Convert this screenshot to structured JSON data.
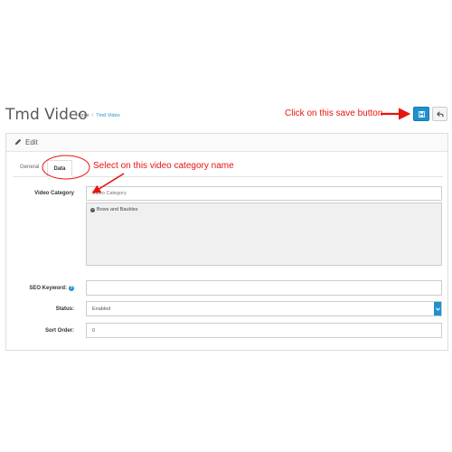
{
  "header": {
    "title": "Tmd Video",
    "breadcrumb": [
      "Home",
      "/",
      "Tmd Video"
    ]
  },
  "panel": {
    "heading": "Edit"
  },
  "tabs": [
    {
      "label": "General",
      "active": false
    },
    {
      "label": "Data",
      "active": true
    }
  ],
  "form": {
    "video_category": {
      "label": "Video Category",
      "placeholder": "Video Category",
      "selected": [
        "Bows and Baubles"
      ]
    },
    "seo_keyword": {
      "label": "SEO Keyword:",
      "value": ""
    },
    "status": {
      "label": "Status:",
      "value": "Enabled"
    },
    "sort_order": {
      "label": "Sort Order:",
      "value": "0"
    }
  },
  "annotations": {
    "save_note": "Click on this save button",
    "category_note": "Select on this video category name"
  },
  "colors": {
    "primary": "#1e91cf",
    "annotation": "#e8140f"
  },
  "icons": {
    "save": "floppy-disk-icon",
    "back": "reply-arrow-icon",
    "edit": "pencil-icon",
    "remove": "minus-circle-icon",
    "help": "info-icon",
    "dropdown": "chevron-down-icon"
  }
}
